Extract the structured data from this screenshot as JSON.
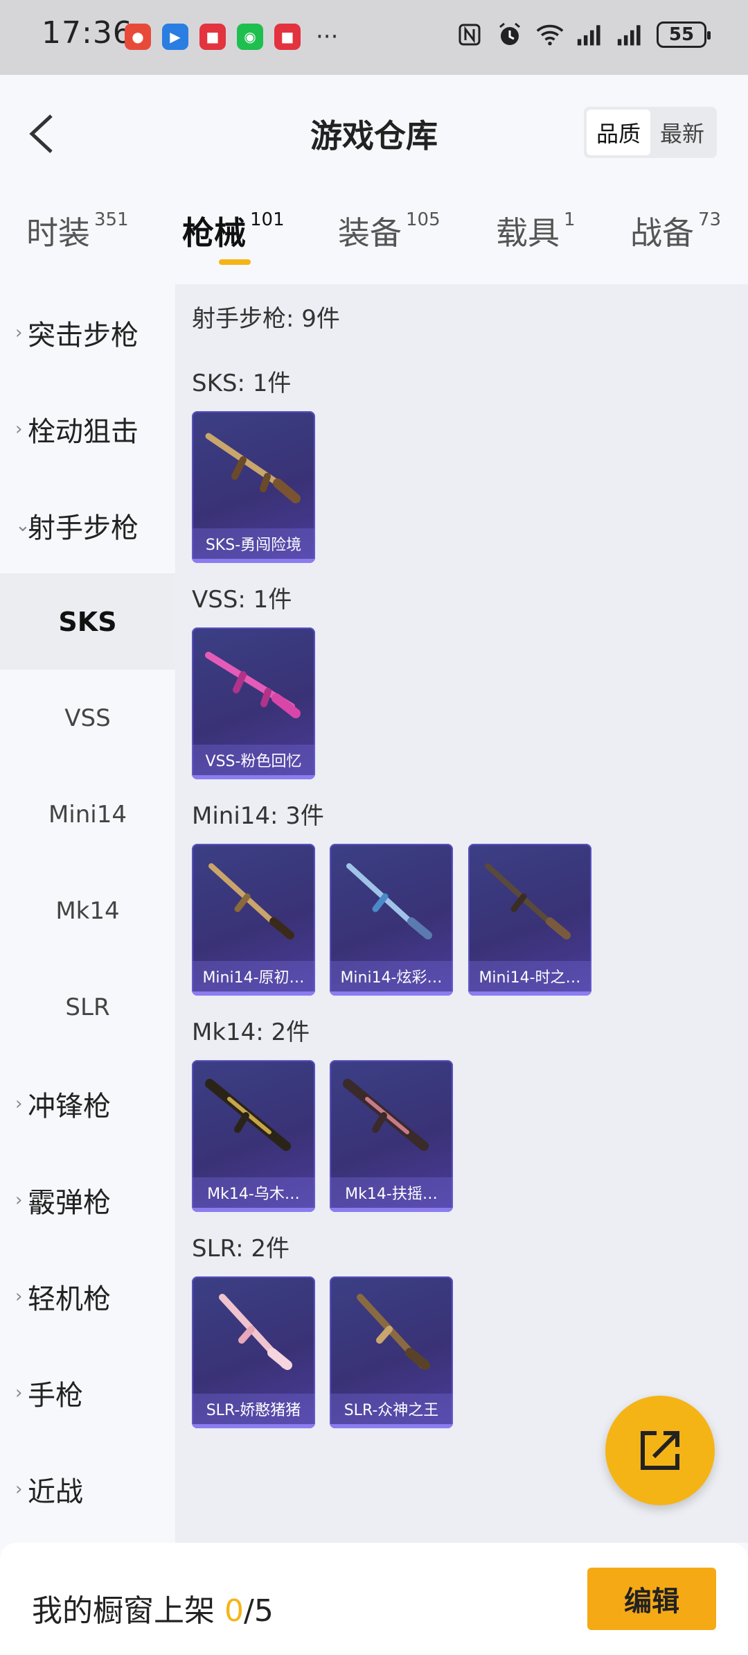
{
  "status_bar": {
    "time": "17:36",
    "battery": "55",
    "more": "···"
  },
  "header": {
    "title": "游戏仓库",
    "sort_options": [
      "品质",
      "最新"
    ],
    "sort_selected": "品质"
  },
  "tabs": [
    {
      "label": "时装",
      "count": "351"
    },
    {
      "label": "枪械",
      "count": "101"
    },
    {
      "label": "装备",
      "count": "105"
    },
    {
      "label": "载具",
      "count": "1"
    },
    {
      "label": "战备",
      "count": "73"
    }
  ],
  "active_tab": "枪械",
  "sidebar": {
    "categories": [
      {
        "label": "突击步枪"
      },
      {
        "label": "栓动狙击"
      },
      {
        "label": "射手步枪"
      },
      {
        "label": "冲锋枪"
      },
      {
        "label": "霰弹枪"
      },
      {
        "label": "轻机枪"
      },
      {
        "label": "手枪"
      },
      {
        "label": "近战"
      }
    ],
    "sub_items": [
      "SKS",
      "VSS",
      "Mini14",
      "Mk14",
      "SLR"
    ],
    "active_sub": "SKS"
  },
  "content": {
    "category_heading": "射手步枪: 9件",
    "groups": [
      {
        "heading": "SKS: 1件",
        "items": [
          "SKS-勇闯险境"
        ]
      },
      {
        "heading": "VSS: 1件",
        "items": [
          "VSS-粉色回忆"
        ]
      },
      {
        "heading": "Mini14: 3件",
        "items": [
          "Mini14-原初…",
          "Mini14-炫彩…",
          "Mini14-时之…"
        ]
      },
      {
        "heading": "Mk14: 2件",
        "items": [
          "Mk14-乌木…",
          "Mk14-扶摇…"
        ]
      },
      {
        "heading": "SLR: 2件",
        "items": [
          "SLR-娇憨猪猪",
          "SLR-众神之王"
        ]
      }
    ]
  },
  "bottom": {
    "shelf_label": "我的橱窗上架 ",
    "shelf_current": "0",
    "shelf_total": "/5",
    "edit_label": "编辑"
  },
  "colors": {
    "accent": "#f5b416",
    "card_bg": "#3a3276"
  }
}
